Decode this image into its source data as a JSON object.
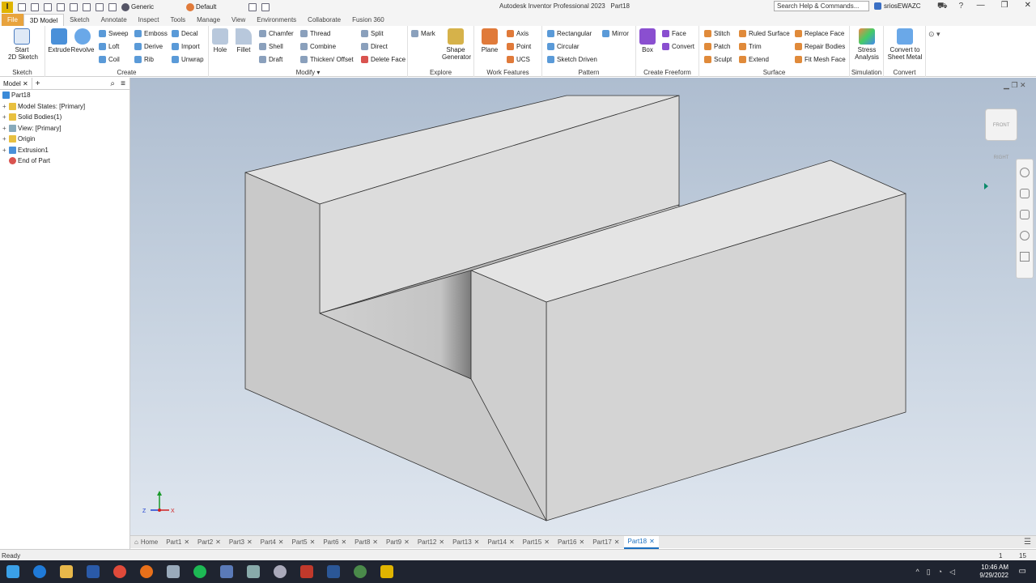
{
  "app": {
    "logo": "I",
    "title": "Autodesk Inventor Professional 2023",
    "doc": "Part18",
    "material": "Generic",
    "appearance": "Default"
  },
  "search": {
    "placeholder": "Search Help & Commands..."
  },
  "user": {
    "name": "sriosEWAZC"
  },
  "ribbon_tabs": [
    "File",
    "3D Model",
    "Sketch",
    "Annotate",
    "Inspect",
    "Tools",
    "Manage",
    "View",
    "Environments",
    "Collaborate",
    "Fusion 360"
  ],
  "panels": {
    "sketch": {
      "title": "Sketch",
      "start": "Start\n2D Sketch"
    },
    "create": {
      "title": "Create",
      "extrude": "Extrude",
      "revolve": "Revolve",
      "sweep": "Sweep",
      "loft": "Loft",
      "coil": "Coil",
      "emboss": "Emboss",
      "derive": "Derive",
      "rib": "Rib",
      "decal": "Decal",
      "import": "Import",
      "unwrap": "Unwrap"
    },
    "modify": {
      "title": "Modify",
      "hole": "Hole",
      "fillet": "Fillet",
      "chamfer": "Chamfer",
      "shell": "Shell",
      "draft": "Draft",
      "thread": "Thread",
      "combine": "Combine",
      "thicken": "Thicken/ Offset",
      "split": "Split",
      "direct": "Direct",
      "delete_face": "Delete Face"
    },
    "explore": {
      "title": "Explore",
      "mark": "Mark",
      "shape_gen": "Shape\nGenerator"
    },
    "work": {
      "title": "Work Features",
      "plane": "Plane",
      "axis": "Axis",
      "point": "Point",
      "ucs": "UCS"
    },
    "pattern": {
      "title": "Pattern",
      "rectangular": "Rectangular",
      "circular": "Circular",
      "sketch_driven": "Sketch Driven",
      "mirror": "Mirror"
    },
    "freeform": {
      "title": "Create Freeform",
      "box": "Box",
      "face": "Face",
      "convert": "Convert"
    },
    "surface": {
      "title": "Surface",
      "stitch": "Stitch",
      "patch": "Patch",
      "sculpt": "Sculpt",
      "ruled": "Ruled Surface",
      "trim": "Trim",
      "extend": "Extend",
      "replace": "Replace Face",
      "repair": "Repair Bodies",
      "fitmesh": "Fit Mesh Face"
    },
    "simulation": {
      "title": "Simulation",
      "stress": "Stress\nAnalysis"
    },
    "convert": {
      "title": "Convert",
      "sheet": "Convert to\nSheet Metal"
    }
  },
  "browser": {
    "tab": "Model",
    "items": [
      "Part18",
      "Model States: [Primary]",
      "Solid Bodies(1)",
      "View: [Primary]",
      "Origin",
      "Extrusion1",
      "End of Part"
    ]
  },
  "doc_tabs": [
    "Home",
    "Part1",
    "Part2",
    "Part3",
    "Part4",
    "Part5",
    "Part6",
    "Part8",
    "Part9",
    "Part12",
    "Part13",
    "Part14",
    "Part15",
    "Part16",
    "Part17",
    "Part18"
  ],
  "status": {
    "text": "Ready",
    "num1": "1",
    "num2": "15"
  },
  "clock": {
    "time": "10:46 AM",
    "date": "9/29/2022"
  },
  "triad": {
    "z": "Z",
    "x": "X"
  },
  "viewcube": {
    "top": "FRONT",
    "right": "RIGHT"
  },
  "colors": {
    "accent": "#e8a33d",
    "viewport_top": "#aebdd0",
    "part_face": "#dcdcdc"
  }
}
